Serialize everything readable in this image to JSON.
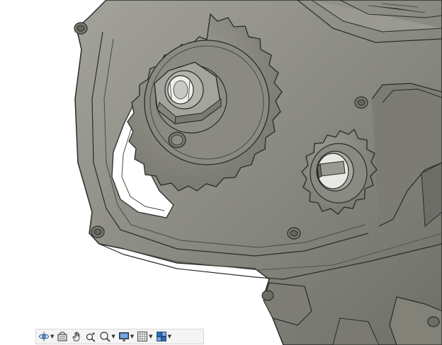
{
  "colors": {
    "background": "#ffffff",
    "housing": "#878780",
    "housing_light": "#9c9c94",
    "housing_dark": "#5e5e58",
    "edge": "#2b2b28",
    "toolbar_bg": "#f4f4f4",
    "icon_blue": "#2f6fb5"
  },
  "viewport": {
    "model": "gearbox-housing-with-sprockets"
  },
  "toolbar": {
    "items": [
      {
        "id": "orbit",
        "icon": "orbit-icon",
        "has_dropdown": true
      },
      {
        "id": "look-at",
        "icon": "look-at-icon",
        "has_dropdown": false
      },
      {
        "id": "pan",
        "icon": "pan-hand-icon",
        "has_dropdown": false
      },
      {
        "id": "zoom",
        "icon": "zoom-icon",
        "has_dropdown": false
      },
      {
        "id": "zoom-window",
        "icon": "zoom-window-icon",
        "has_dropdown": true
      },
      {
        "id": "display-settings",
        "icon": "display-monitor-icon",
        "has_dropdown": true
      },
      {
        "id": "grid-settings",
        "icon": "grid-icon",
        "has_dropdown": true
      },
      {
        "id": "viewports",
        "icon": "viewports-icon",
        "has_dropdown": true
      }
    ]
  }
}
